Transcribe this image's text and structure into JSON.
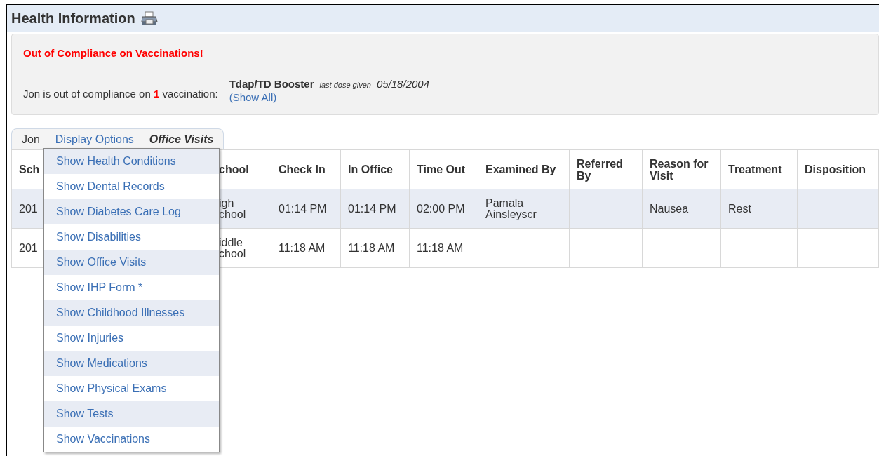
{
  "header": {
    "title": "Health Information"
  },
  "alert": {
    "title": "Out of Compliance on Vaccinations!",
    "message": "Jon is out of compliance on **1** vaccination:",
    "vaccine": "Tdap/TD Booster",
    "dose_label": "last dose given",
    "dose_date": "05/18/2004",
    "show_all": "(Show All)"
  },
  "tabs": [
    {
      "label": "Jon",
      "kind": "plain"
    },
    {
      "label": "Display Options",
      "kind": "link"
    },
    {
      "label": "Office Visits",
      "kind": "current"
    }
  ],
  "table": {
    "columns": [
      "Sch",
      "chool",
      "Check In",
      "In Office",
      "Time Out",
      "Examined By",
      "Referred By",
      "Reason for Visit",
      "Treatment",
      "Disposition"
    ],
    "rows": [
      {
        "cells": [
          "201",
          "igh\nchool",
          "01:14 PM",
          "01:14 PM",
          "02:00 PM",
          "Pamala\nAinsleyscr",
          "",
          "Nausea",
          "Rest",
          ""
        ]
      },
      {
        "cells": [
          "201",
          "iddle\nchool",
          "11:18 AM",
          "11:18 AM",
          "11:18 AM",
          "",
          "",
          "",
          "",
          ""
        ]
      }
    ]
  },
  "menu": {
    "items": [
      {
        "label": "Show Health Conditions",
        "selected": true
      },
      {
        "label": "Show Dental Records",
        "selected": false
      },
      {
        "label": "Show Diabetes Care Log",
        "selected": false
      },
      {
        "label": "Show Disabilities",
        "selected": false
      },
      {
        "label": "Show Office Visits",
        "selected": false
      },
      {
        "label": "Show IHP Form *",
        "selected": false
      },
      {
        "label": "Show Childhood Illnesses",
        "selected": false
      },
      {
        "label": "Show Injuries",
        "selected": false
      },
      {
        "label": "Show Medications",
        "selected": false
      },
      {
        "label": "Show Physical Exams",
        "selected": false
      },
      {
        "label": "Show Tests",
        "selected": false
      },
      {
        "label": "Show Vaccinations",
        "selected": false
      }
    ]
  }
}
